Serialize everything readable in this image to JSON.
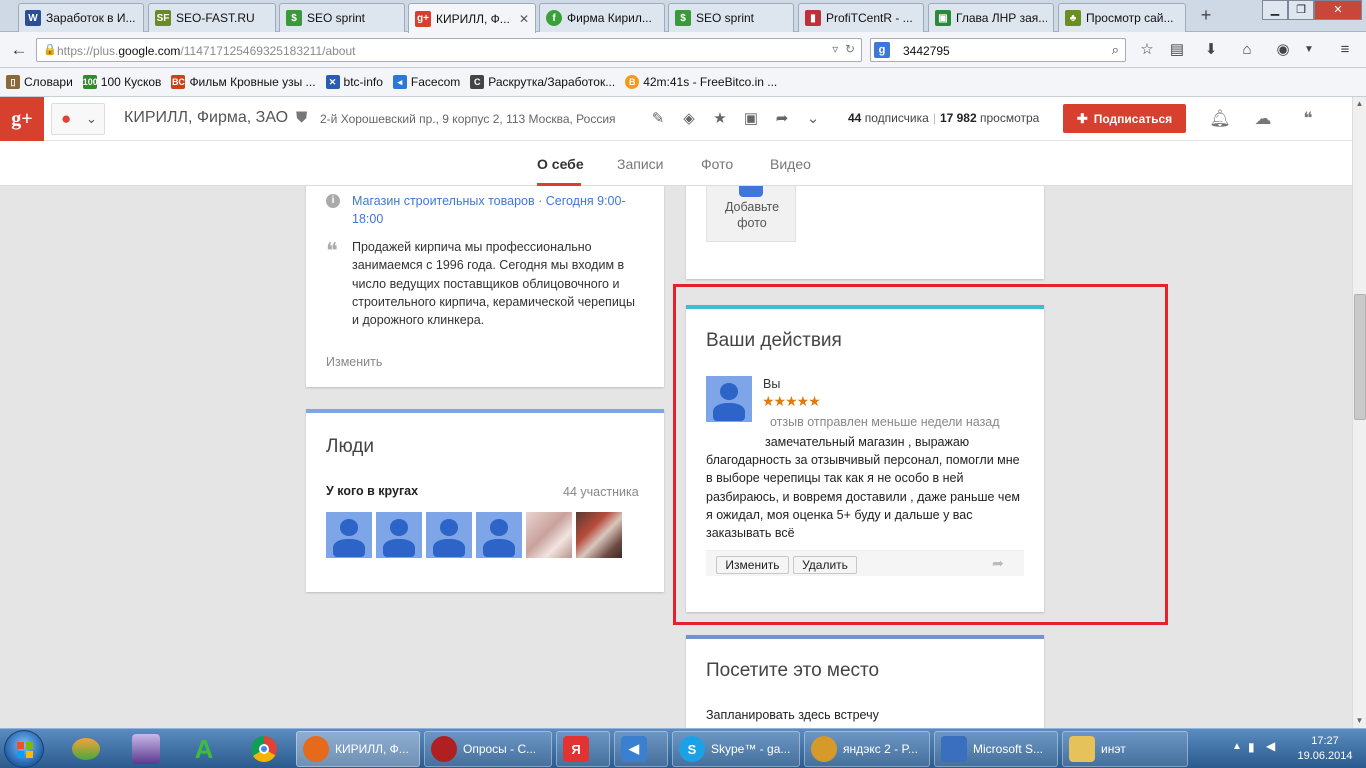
{
  "browser": {
    "tabs": [
      {
        "label": "Заработок в И...",
        "icon": "site-icon",
        "color": "#2a4f95"
      },
      {
        "label": "SEO-FAST.RU",
        "icon": "sf-icon",
        "color": "#6a8a2a"
      },
      {
        "label": "SEO sprint",
        "icon": "dollar-icon",
        "color": "#3a9a3a"
      },
      {
        "label": "КИРИЛЛ, Ф...",
        "icon": "gplus-icon",
        "color": "#d73f2f"
      },
      {
        "label": "Фирма Кирил...",
        "icon": "green-circle-icon",
        "color": "#3aa13a"
      },
      {
        "label": "SEO sprint",
        "icon": "dollar-icon",
        "color": "#3a9a3a"
      },
      {
        "label": "ProfiTCentR - ...",
        "icon": "chart-icon",
        "color": "#c0303a"
      },
      {
        "label": "Глава ЛНР зая...",
        "icon": "news-icon",
        "color": "#2b8a3a"
      },
      {
        "label": "Просмотр сай...",
        "icon": "tree-icon",
        "color": "#6b8e23"
      }
    ],
    "url_prefix": "https://plus.",
    "url_domain": "google.com",
    "url_path": "/114717125469325183211/about",
    "search_value": "3442795",
    "bookmarks": [
      {
        "label": "Словари",
        "color": "#8a6a3a"
      },
      {
        "label": "100 Кусков",
        "color": "#2e8b2e"
      },
      {
        "label": "Фильм Кровные узы ...",
        "color": "#c8441a"
      },
      {
        "label": "btc-info",
        "color": "#2a5db0"
      },
      {
        "label": "Facecom",
        "color": "#2a7ad5"
      },
      {
        "label": "Раскрутка/Заработок...",
        "color": "#444444"
      },
      {
        "label": "42m:41s - FreeBitco.in ...",
        "color": "#f39a1e"
      }
    ]
  },
  "gplus": {
    "page_title": "КИРИЛЛ, Фирма, ЗАО",
    "address": "2-й Хорошевский пр., 9 корпус 2, 113 Москва, Россия",
    "followers_count": "44",
    "followers_label": "подписчика",
    "views_count": "17 982",
    "views_label": "просмотра",
    "follow_label": "Подписаться",
    "tabs": [
      "О себе",
      "Записи",
      "Фото",
      "Видео"
    ]
  },
  "about_card": {
    "category_link": "Магазин строительных товаров",
    "hours_link": "Сегодня 9:00-18:00",
    "description": "Продажей кирпича мы профессионально занимаемся с 1996 года. Сегодня мы входим в число ведущих поставщиков облицовочного и строительного кирпича, керамической черепицы и дорожного клинкера.",
    "edit_label": "Изменить"
  },
  "people_card": {
    "title": "Люди",
    "subtitle": "У кого в кругах",
    "count": "44 участника"
  },
  "photo_card": {
    "add_photo_label": "Добавьте фото"
  },
  "actions_card": {
    "title": "Ваши действия",
    "author": "Вы",
    "stars": "★★★★★",
    "meta": "отзыв отправлен меньше недели назад",
    "review": "замечательный магазин , выражаю благодарность за отзывчивый персонал, помогли мне в выборе черепицы так как я не особо в ней разбираюсь, и вовремя доставили , даже раньше чем я ожидал, моя оценка 5+ буду и дальше у вас заказывать всё",
    "edit_label": "Изменить",
    "delete_label": "Удалить"
  },
  "visit_card": {
    "title": "Посетите это место",
    "plan_label": "Запланировать здесь встречу"
  },
  "taskbar": {
    "tasks": [
      {
        "label": "КИРИЛЛ, Ф...",
        "icon": "firefox-icon",
        "color": "#e66a1c"
      },
      {
        "label": "Опросы - С...",
        "icon": "browser-icon",
        "color": "#b02020"
      },
      {
        "label": "",
        "icon": "yandex-icon",
        "color": "#e23232"
      },
      {
        "label": "",
        "icon": "speaker-icon",
        "color": "#3a7fd0"
      },
      {
        "label": "Skype™ - ga...",
        "icon": "skype-icon",
        "color": "#1da1e6"
      },
      {
        "label": "яндэкс 2 - P...",
        "icon": "paint-icon",
        "color": "#d69a2a"
      },
      {
        "label": "Microsoft S...",
        "icon": "microsoft-icon",
        "color": "#3a6fc0"
      },
      {
        "label": "инэт",
        "icon": "folder-icon",
        "color": "#e6c25a"
      }
    ],
    "time": "17:27",
    "date": "19.06.2014"
  }
}
